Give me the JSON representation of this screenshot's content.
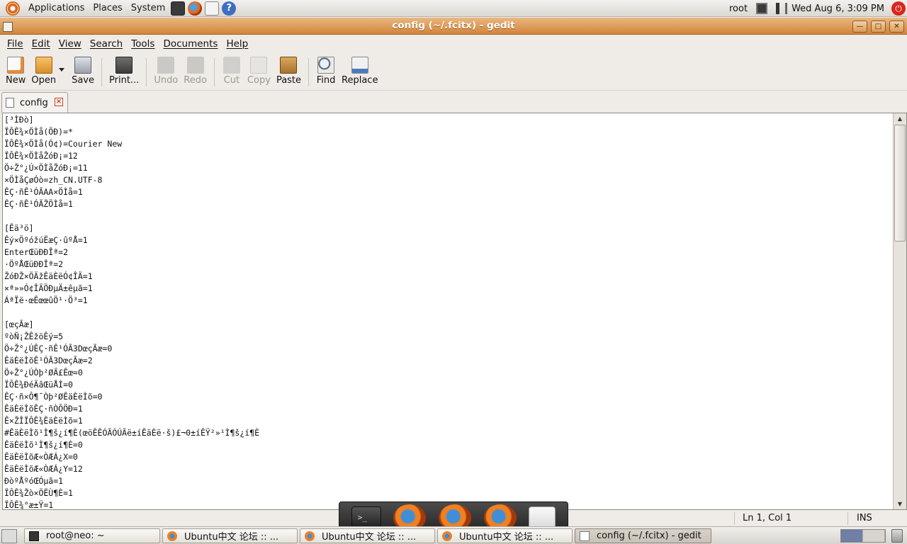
{
  "top_panel": {
    "menus": [
      "Applications",
      "Places",
      "System"
    ],
    "user": "root",
    "clock": "Wed Aug  6,  3:09 PM"
  },
  "window": {
    "title": "config (~/.fcitx) - gedit"
  },
  "menubar": [
    "File",
    "Edit",
    "View",
    "Search",
    "Tools",
    "Documents",
    "Help"
  ],
  "toolbar": {
    "new": "New",
    "open": "Open",
    "save": "Save",
    "print": "Print...",
    "undo": "Undo",
    "redo": "Redo",
    "cut": "Cut",
    "copy": "Copy",
    "paste": "Paste",
    "find": "Find",
    "replace": "Replace"
  },
  "tab": {
    "label": "config",
    "close": "×"
  },
  "editor": {
    "lines": [
      "[³ÌÐò]",
      "ÏÔÊ¾×ÖÌå(ÖÐ)=*",
      "ÏÔÊ¾×ÖÌå(Ó¢)=Courier New",
      "ÏÔÊ¾×ÖÌåŽóÐ¡=12",
      "Ö÷Ž°¿Ú×ÖÌåŽóÐ¡=11",
      "×ÖÌåÇøÓò=zh_CN.UTF-8",
      "ÊÇ·ñÊ¹ÓÃAA×ÖÌå=1",
      "ÊÇ·ñÊ¹ÓÃŽÖÌå=1",
      "",
      "[Êä³ö]",
      "Êý×ÖºóžúËæÇ·ûºÅ=1",
      "EnterŒüÐÐÎª=2",
      "·ÖºÅŒüÐÐÎª=2",
      "ŽóÐŽ×ÖÄžÊäÈëÓ¢ÎÄ=1",
      "×ª»»Ó¢ÎÄÖÐµÄ±êµã=1",
      "ÁªÏë·œÊœœûÖ¹·Ö³=1",
      "",
      "[œçÃæ]",
      "ºòÑ¡ŽÊžöÊý=5",
      "Ö÷Ž°¿ÚÊÇ·ñÊ¹ÓÃ3DœçÃæ=0",
      "ÊäÈëÌõÊ¹ÓÃ3DœçÃæ=2",
      "Ö÷Ž°¿ÚÒþ²ØÄ£Êœ=0",
      "ÏÔÊ¾ÐéÄâŒüÅÌ=0",
      "ÊÇ·ñ×Ô¶¯Òþ²ØÊäÈëÌõ=0",
      "ÊäÈëÌõÊÇ·ñÒÔÖÐ=1",
      "Ê×ŽÎÏÔÊ¾ÊäÈëÌõ=1",
      "#ÊäÈëÌõ¹Ì¶š¿í¶È(œöÊÊÓÃÓÚÂë±íÊäÈë·š)£¬0±íÊŸ²»¹Ì¶š¿í¶È",
      "ÊäÈëÌõ¹Ì¶š¿í¶È=0",
      "ÊäÈëÌõÆ«ÒÆÁ¿X=0",
      "ÊäÈëÌõÆ«ÒÆÁ¿Y=12",
      "ÐòºÅºóŒÓµã=1",
      "ÏÔÊ¾Žò×ÖËÙ¶È=1",
      "ÏÔÊ¾°æ±Ÿ=1"
    ]
  },
  "statusbar": {
    "position": "Ln 1, Col 1",
    "mode": "INS"
  },
  "taskbar": {
    "items": [
      {
        "label": "root@neo: ~",
        "icon": "terminal-icon"
      },
      {
        "label": "Ubuntu中文 论坛  :: ...",
        "icon": "firefox-icon"
      },
      {
        "label": "Ubuntu中文 论坛  :: ...",
        "icon": "firefox-icon"
      },
      {
        "label": "Ubuntu中文 论坛  :: ...",
        "icon": "firefox-icon"
      },
      {
        "label": "config (~/.fcitx) - gedit",
        "icon": "gedit-icon"
      }
    ]
  },
  "dock": {
    "terminal_glyph": ">_"
  },
  "colors": {
    "titlebar": "#d3843a",
    "panel": "#e6e2dc"
  }
}
